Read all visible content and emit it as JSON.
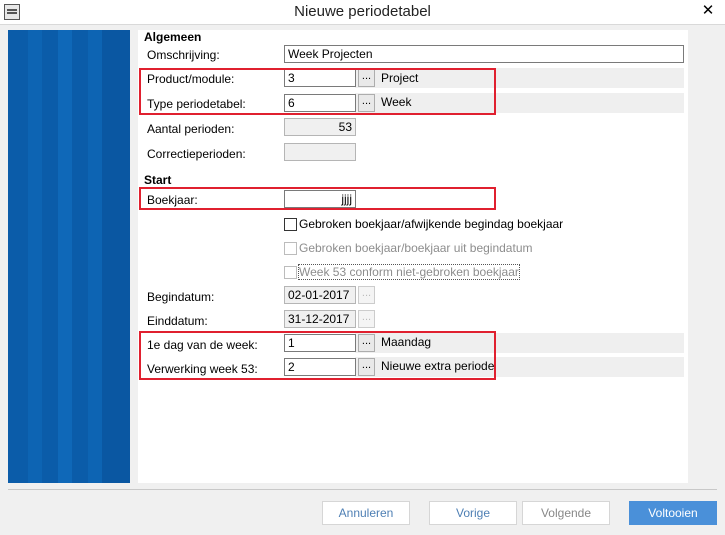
{
  "window": {
    "title": "Nieuwe periodetabel",
    "close_glyph": "✕"
  },
  "sections": {
    "general": "Algemeen",
    "start": "Start"
  },
  "fields": {
    "description": {
      "label": "Omschrijving:",
      "value": "Week Projecten"
    },
    "product_module": {
      "label": "Product/module:",
      "value": "3",
      "desc": "Project"
    },
    "table_type": {
      "label": "Type periodetabel:",
      "value": "6",
      "desc": "Week"
    },
    "num_periods": {
      "label": "Aantal perioden:",
      "value": "53"
    },
    "correction_periods": {
      "label": "Correctieperioden:",
      "value": ""
    },
    "fiscal_year": {
      "label": "Boekjaar:",
      "value": "jjjj"
    },
    "start_date": {
      "label": "Begindatum:",
      "value": "02-01-2017"
    },
    "end_date": {
      "label": "Einddatum:",
      "value": "31-12-2017"
    },
    "first_day": {
      "label": "1e dag van de week:",
      "value": "1",
      "desc": "Maandag"
    },
    "week53": {
      "label": "Verwerking week 53:",
      "value": "2",
      "desc": "Nieuwe extra periode"
    }
  },
  "checkboxes": {
    "broken_year_start_day": "Gebroken boekjaar/afwijkende begindag boekjaar",
    "broken_year_from_date": "Gebroken boekjaar/boekjaar uit begindatum",
    "week53_conform": "Week 53 conform niet-gebroken boekjaar"
  },
  "lookup_glyph": "...",
  "buttons": {
    "cancel": "Annuleren",
    "previous": "Vorige",
    "next": "Volgende",
    "finish": "Voltooien"
  },
  "colors": {
    "sidebar": "#0a5aa8",
    "highlight": "#e0202f",
    "primary_button": "#4a90d9"
  }
}
